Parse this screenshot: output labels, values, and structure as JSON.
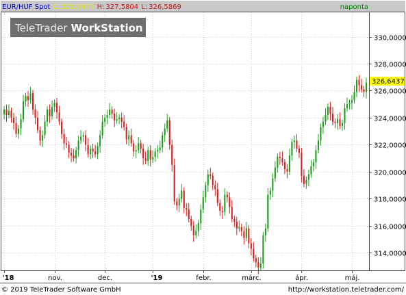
{
  "header": {
    "symbol": "EUR/HUF Spot",
    "close_label": "C:",
    "close_value": "326,6437",
    "high_label": "H:",
    "high_value": "327,5804",
    "low_label": "L:",
    "low_value": "326,5869",
    "interval": "naponta"
  },
  "watermark": {
    "brand": "TeleTrader",
    "product": "WorkStation"
  },
  "footer": {
    "copyright": "© 2019 TeleTrader Software GmbH",
    "url": "http://workstation.teletrader.com/"
  },
  "colors": {
    "up": "#1e9e1e",
    "down": "#d81e1e",
    "header_bg": "#c8c8c8",
    "last_price_bg": "#ffff00",
    "close_text": "#e8e800",
    "high_low_text": "#d01010",
    "interval_text": "#008000",
    "symbol_text": "#0000b0"
  },
  "chart_data": {
    "type": "candlestick",
    "title": "EUR/HUF Spot",
    "interval": "naponta",
    "last_price": "326,6437",
    "y_ticks": [
      "314,0000",
      "316,0000",
      "318,0000",
      "320,0000",
      "322,0000",
      "324,0000",
      "326,0000",
      "328,0000",
      "330,0000"
    ],
    "y_tick_values": [
      314,
      316,
      318,
      320,
      322,
      324,
      326,
      328,
      330
    ],
    "ylim": [
      312.7,
      331.8
    ],
    "x_ticks": [
      "'18",
      "nov.",
      "dec.",
      "'19",
      "febr.",
      "márc.",
      "ápr.",
      "máj."
    ],
    "x_tick_index": [
      0,
      21,
      42,
      62,
      83,
      103,
      124,
      145
    ],
    "grid": true,
    "series": [
      {
        "values": [
          324.6,
          324.2,
          324.5,
          324.0,
          323.6,
          322.8,
          323.2,
          323.9,
          325.2,
          325.6,
          325.3,
          325.8,
          324.6,
          324.0,
          323.1,
          322.3,
          322.7,
          323.7,
          324.6,
          324.1,
          324.8,
          325.1,
          324.4,
          323.7,
          322.8,
          322.1,
          322.0,
          321.4,
          321.2,
          321.0,
          321.6,
          322.3,
          322.6,
          322.7,
          322.0,
          321.3,
          321.7,
          321.5,
          321.3,
          321.9,
          322.7,
          323.7,
          324.0,
          324.2,
          324.6,
          324.3,
          323.8,
          323.9,
          324.0,
          323.7,
          323.3,
          322.4,
          322.7,
          322.1,
          321.5,
          321.6,
          322.1,
          321.7,
          321.0,
          320.8,
          321.6,
          320.9,
          321.1,
          321.5,
          321.6,
          321.8,
          322.7,
          323.2,
          323.8,
          322.0,
          320.5,
          317.8,
          317.5,
          318.0,
          318.6,
          317.3,
          317.2,
          316.5,
          316.0,
          315.3,
          315.6,
          316.2,
          317.2,
          318.1,
          319.0,
          319.8,
          319.7,
          319.0,
          318.7,
          317.7,
          317.1,
          317.0,
          318.3,
          318.1,
          317.4,
          316.5,
          316.3,
          315.8,
          315.9,
          315.6,
          315.1,
          315.8,
          314.7,
          314.3,
          313.6,
          313.3,
          312.9,
          313.2,
          315.3,
          315.8,
          318.3,
          318.6,
          319.5,
          320.3,
          321.1,
          321.0,
          320.7,
          320.2,
          320.0,
          321.2,
          322.2,
          322.3,
          321.7,
          321.4,
          319.7,
          319.1,
          319.4,
          319.8,
          320.4,
          320.7,
          321.6,
          322.3,
          323.3,
          323.7,
          324.2,
          324.8,
          324.3,
          323.7,
          323.6,
          323.9,
          323.4,
          323.6,
          324.7,
          325.0,
          325.1,
          325.3,
          325.9,
          326.8,
          326.4,
          326.1,
          325.9,
          326.6
        ]
      }
    ]
  }
}
